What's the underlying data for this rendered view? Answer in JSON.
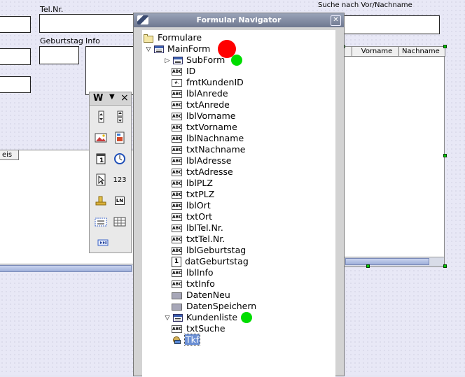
{
  "form": {
    "labels": {
      "telnr": "Tel.Nr.",
      "geburtstag": "Geburtstag",
      "info": "Info",
      "suche": "Suche nach Vor/Nachname"
    },
    "grid_left": {
      "col1": "eis"
    },
    "grid_right": {
      "cols": [
        "Vorname",
        "Nachname"
      ]
    }
  },
  "toolbox": {
    "title": "W",
    "menu_arrow": "▼",
    "close": "×",
    "tools": [
      "spin-button-icon",
      "scroll-bar-icon",
      "image-button-icon",
      "image-control-icon",
      "date-field-icon",
      "time-field-icon",
      "file-selection-icon",
      "numeric-field-icon",
      "currency-field-icon",
      "pattern-field-icon",
      "group-box-icon",
      "table-control-icon",
      "navigation-bar-icon"
    ],
    "numeric_label": "123",
    "pattern_label": "LN"
  },
  "navigator": {
    "title": "Formular Navigator",
    "close": "✕",
    "tree": [
      {
        "label": "Formulare",
        "icon": "folder-icon",
        "level": 0,
        "expander": ""
      },
      {
        "label": "MainForm",
        "icon": "form-icon",
        "level": 1,
        "expander": "▽"
      },
      {
        "label": "SubForm",
        "icon": "form-icon",
        "level": 2,
        "expander": "▷"
      },
      {
        "label": "ID",
        "icon": "text-field-icon",
        "level": 3
      },
      {
        "label": "fmtKundenID",
        "icon": "formatted-field-icon",
        "level": 3
      },
      {
        "label": "lblAnrede",
        "icon": "label-icon",
        "level": 3
      },
      {
        "label": "txtAnrede",
        "icon": "text-field-icon",
        "level": 3
      },
      {
        "label": "lblVorname",
        "icon": "label-icon",
        "level": 3
      },
      {
        "label": "txtVorname",
        "icon": "text-field-icon",
        "level": 3
      },
      {
        "label": "lblNachname",
        "icon": "label-icon",
        "level": 3
      },
      {
        "label": "txtNachname",
        "icon": "text-field-icon",
        "level": 3
      },
      {
        "label": "lblAdresse",
        "icon": "label-icon",
        "level": 3
      },
      {
        "label": "txtAdresse",
        "icon": "text-field-icon",
        "level": 3
      },
      {
        "label": "lblPLZ",
        "icon": "label-icon",
        "level": 3
      },
      {
        "label": "txtPLZ",
        "icon": "text-field-icon",
        "level": 3
      },
      {
        "label": "lblOrt",
        "icon": "label-icon",
        "level": 3
      },
      {
        "label": "txtOrt",
        "icon": "text-field-icon",
        "level": 3
      },
      {
        "label": "lblTel.Nr.",
        "icon": "label-icon",
        "level": 3
      },
      {
        "label": "txtTel.Nr.",
        "icon": "text-field-icon",
        "level": 3
      },
      {
        "label": "lblGeburtstag",
        "icon": "label-icon",
        "level": 3
      },
      {
        "label": "datGeburtstag",
        "icon": "date-field-icon",
        "level": 3
      },
      {
        "label": "lblInfo",
        "icon": "label-icon",
        "level": 3
      },
      {
        "label": "txtInfo",
        "icon": "text-field-icon",
        "level": 3
      },
      {
        "label": "DatenNeu",
        "icon": "push-button-icon",
        "level": 3
      },
      {
        "label": "DatenSpeichern",
        "icon": "push-button-icon",
        "level": 3
      },
      {
        "label": "Kundenliste",
        "icon": "form-icon",
        "level": 2,
        "expander": "▽"
      },
      {
        "label": "txtSuche",
        "icon": "text-field-icon",
        "level": 3
      },
      {
        "label": "Tkf",
        "icon": "table-control-icon",
        "level": 3,
        "selected": true
      }
    ],
    "markers": {
      "mainform": "#ff0000",
      "subform": "#00dd00",
      "kundenliste": "#00dd00"
    }
  }
}
